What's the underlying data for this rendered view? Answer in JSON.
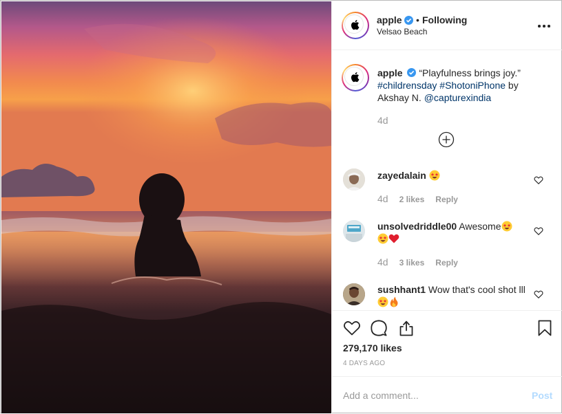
{
  "colors": {
    "accent_blue": "#3897f0",
    "link_blue": "#003569",
    "gray_text": "#999999",
    "post_disabled": "#b3dbff",
    "love_red": "#ed4956"
  },
  "photo": {
    "description_icon": "sunset-beach-photo"
  },
  "header": {
    "username": "apple",
    "separator": "•",
    "follow_status": "Following",
    "location": "Velsao Beach",
    "more_icon": "more-options-icon"
  },
  "caption": {
    "username": "apple",
    "quote": " “Playfulness brings joy.” ",
    "hashtag1": "#childrensday",
    "hashtag2": "#ShotoniPhone",
    "by_text": " by Akshay N. ",
    "mention": "@capturexindia",
    "time": "4d"
  },
  "comments": [
    {
      "username": "zayedalain",
      "text": "",
      "emojis": [
        "star-struck"
      ],
      "time": "4d",
      "likes": "2 likes",
      "reply": "Reply"
    },
    {
      "username": "unsolvedriddle00",
      "text": "Awesome",
      "emojis": [
        "star-struck",
        "star-struck",
        "red-heart"
      ],
      "time": "4d",
      "likes": "3 likes",
      "reply": "Reply"
    },
    {
      "username": "sushhant1",
      "text": "Wow that's cool shot lll",
      "emojis": [
        "star-struck",
        "fire"
      ]
    }
  ],
  "actions": {
    "likes": "279,170 likes",
    "posted": "4 DAYS AGO"
  },
  "add_comment": {
    "placeholder": "Add a comment...",
    "post_label": "Post"
  }
}
